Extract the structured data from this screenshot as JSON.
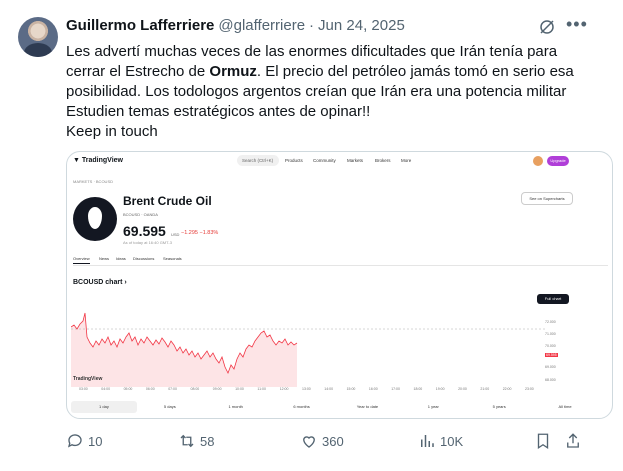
{
  "author": {
    "name": "Guillermo Lafferriere",
    "handle": "@glafferriere",
    "separator": "·",
    "date": "Jun 24, 2025"
  },
  "tweet": {
    "line1": "Les advertí muchas veces de las enormes dificultades que Irán tenía para",
    "line2_pre": "cerrar el Estrecho de ",
    "line2_bold": "Ormuz",
    "line2_post": ". El precio del petróleo jamás tomó en serio esa",
    "line3": "posibilidad. Los todologos argentos creían que Irán era una potencia militar",
    "line4": "Estudien temas estratégicos antes de opinar!!",
    "line5": "Keep in touch"
  },
  "card": {
    "logo": "TradingView",
    "search": "Search (Ctrl+K)",
    "nav": [
      "Products",
      "Community",
      "Markets",
      "Brokers",
      "More"
    ],
    "upgrade": "Upgrade",
    "crumb": "MARKETS · BCOUSD",
    "title": "Brent Crude Oil",
    "sub": "BCOUSD · OANDA",
    "price": "69.595",
    "currency": "USD",
    "change": "−1.295  −1.83%",
    "asof": "As of today at 16:40 GMT-3",
    "see_on": "See on Supercharts",
    "tabs": [
      "Overview",
      "News",
      "Ideas",
      "Discussions",
      "Seasonals"
    ],
    "chart_title": "BCOUSD chart ›",
    "full_chart": "Full chart",
    "watermark": "TradingView",
    "yticks": [
      "72.000",
      "71.000",
      "70.000",
      "69.595",
      "69.000",
      "68.000"
    ],
    "xticks": [
      "03:00",
      "04:00",
      "05:00",
      "06:00",
      "07:00",
      "08:00",
      "09:00",
      "10:00",
      "11:00",
      "12:00",
      "13:00",
      "14:00",
      "15:00",
      "16:00",
      "17:00",
      "18:00",
      "19:00",
      "20:00",
      "21:00",
      "22:00",
      "23:00"
    ],
    "ranges": [
      "1 day",
      "5 days",
      "1 month",
      "6 months",
      "Year to date",
      "1 year",
      "5 years",
      "All time"
    ]
  },
  "stats": {
    "replies": "10",
    "reposts": "58",
    "likes": "360",
    "views": "10K"
  },
  "colors": {
    "line": "#f23645",
    "fill": "#fde4e6",
    "upgrade": "#b03fd8"
  }
}
